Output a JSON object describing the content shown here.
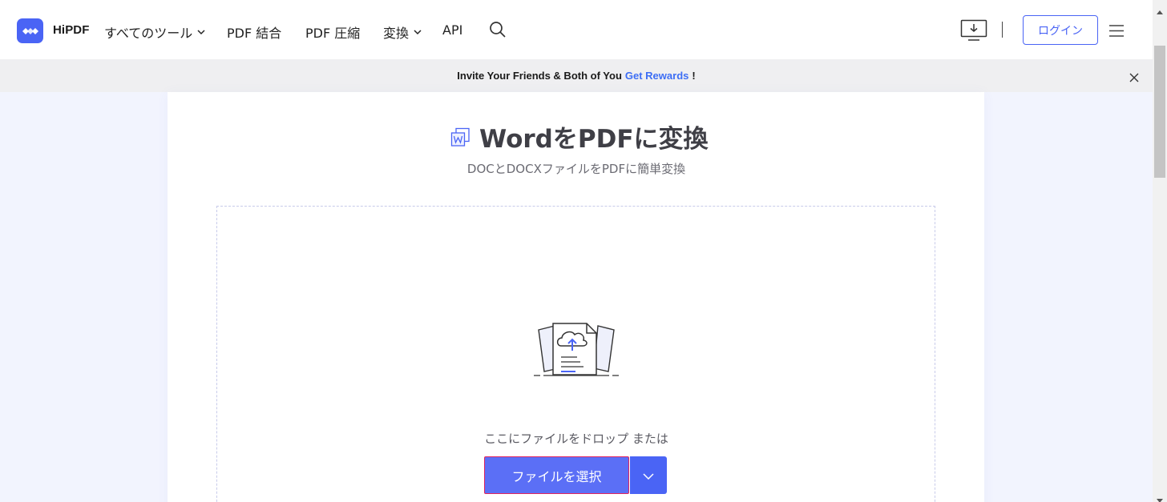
{
  "header": {
    "brand": "HiPDF",
    "nav": [
      {
        "label": "すべてのツール",
        "has_dropdown": true
      },
      {
        "label": "PDF 結合",
        "has_dropdown": false
      },
      {
        "label": "PDF 圧縮",
        "has_dropdown": false
      },
      {
        "label": "変換",
        "has_dropdown": true
      },
      {
        "label": "API",
        "has_dropdown": false
      }
    ],
    "login_label": "ログイン",
    "icons": [
      "hipdf-logo-icon",
      "search-icon",
      "desktop-download-icon",
      "hamburger-menu-icon"
    ]
  },
  "banner": {
    "text": "Invite Your Friends & Both of You",
    "link": "Get Rewards",
    "suffix": "!",
    "close_icon": "close-icon"
  },
  "main": {
    "title": "WordをPDFに変換",
    "title_icon": "word-file-icon",
    "subtitle": "DOCとDOCXファイルをPDFに簡単変換",
    "dropzone": {
      "illustration": "cloud-upload-illustration",
      "drop_text": "ここにファイルをドロップ または",
      "select_label": "ファイルを選択",
      "dropdown_icon": "chevron-down-icon"
    }
  },
  "colors": {
    "accent": "#4a64f5",
    "button": "#5b6ff6",
    "page_bg": "#f2f4fe",
    "banner_bg": "#efeff1",
    "link": "#3d6ef5",
    "highlight_border": "#e0245e"
  }
}
